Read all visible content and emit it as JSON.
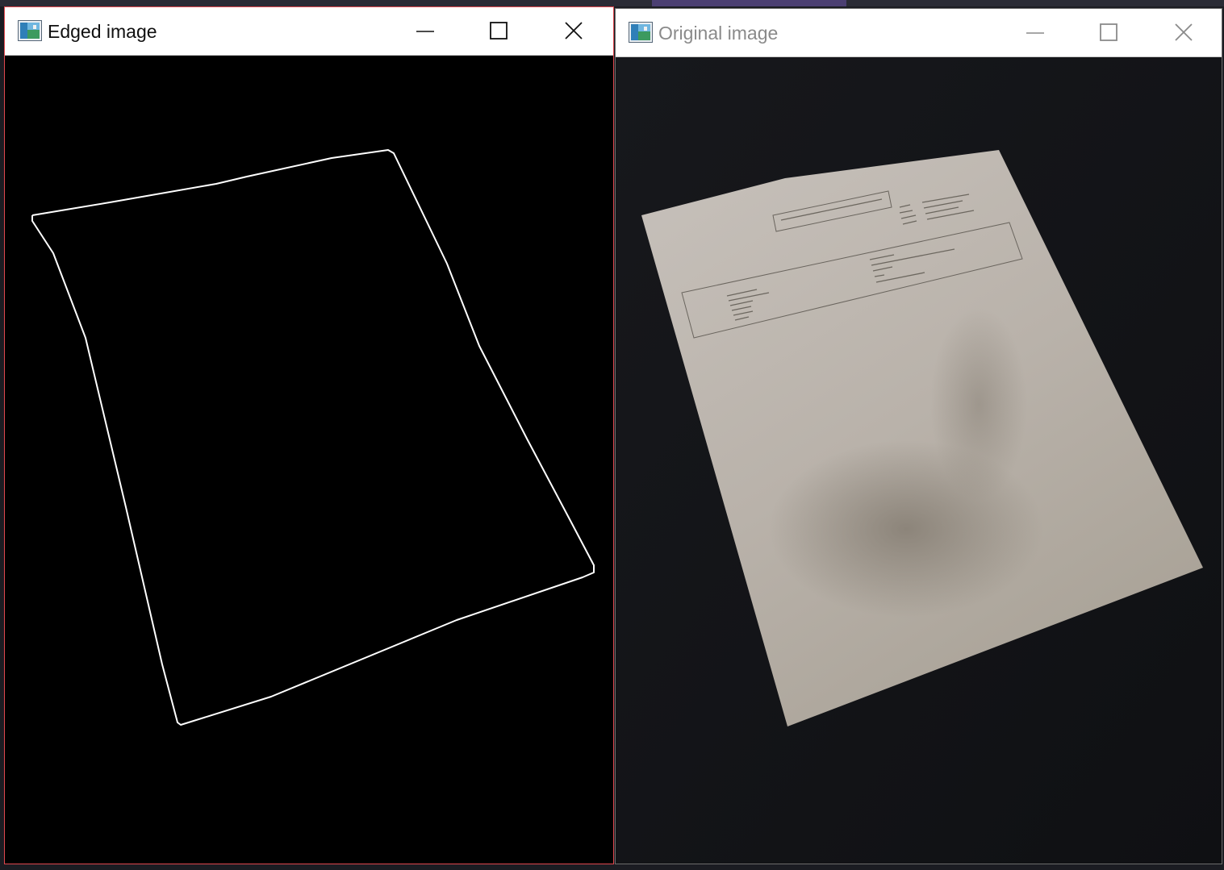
{
  "desktop": {
    "accent_color": "#4b3f72"
  },
  "windows": [
    {
      "title": "Edged image",
      "active": true,
      "border_color": "#e0484e",
      "content": "white-edge-outline-on-black",
      "controls": [
        "minimize-icon",
        "maximize-icon",
        "close-icon"
      ]
    },
    {
      "title": "Original image",
      "active": false,
      "border_color": "#6c6c6c",
      "content": "photo-of-paper-document-on-dark-table",
      "controls": [
        "minimize-icon",
        "maximize-icon",
        "close-icon"
      ]
    }
  ]
}
